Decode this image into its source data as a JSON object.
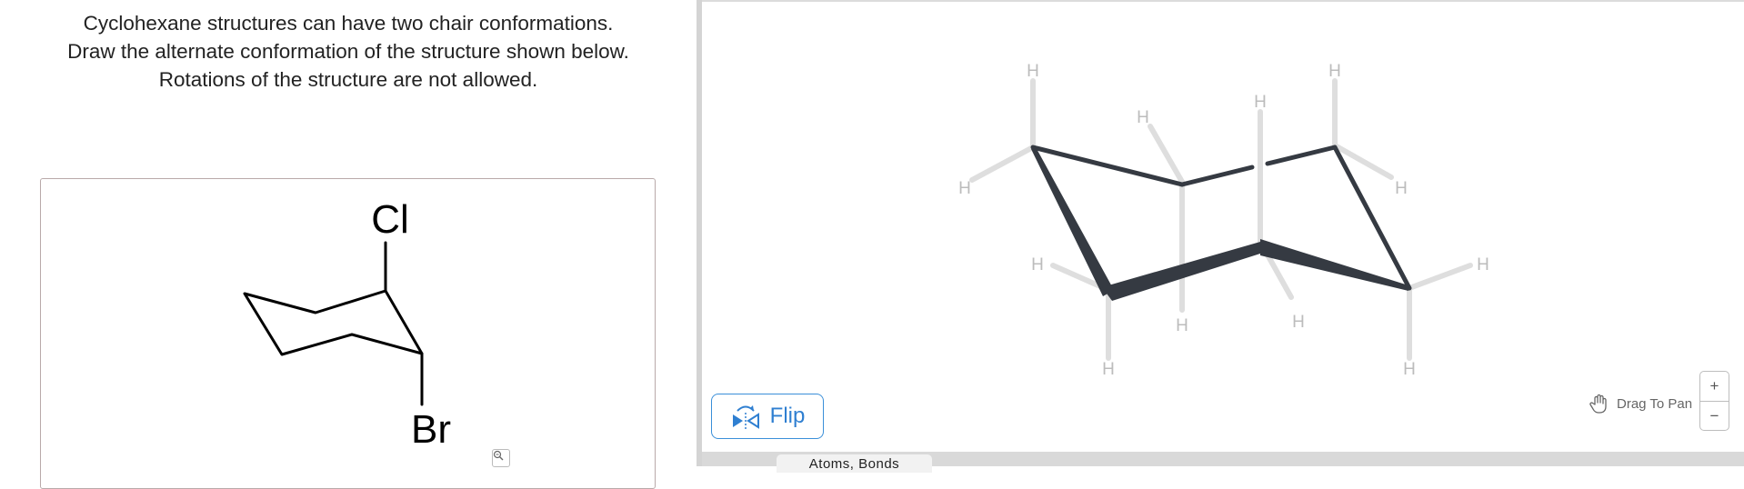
{
  "question": {
    "line1": "Cyclohexane structures can have two chair conformations.",
    "line2": "Draw the alternate conformation of the structure shown below.",
    "line3": "Rotations of the structure are not allowed."
  },
  "structure": {
    "atoms": {
      "top": "Cl",
      "bottom": "Br"
    },
    "zoom_icon": "magnifier-icon"
  },
  "canvas": {
    "hydrogen": "H",
    "bond_color": "#353a42",
    "hydrogen_bond_color": "#dedede",
    "hydrogen_label_color": "#bcbcbc"
  },
  "flip": {
    "label": "Flip",
    "icon": "flip-icon",
    "color": "#2f7fd1"
  },
  "toolbar": {
    "tab_label": "Atoms, Bonds"
  },
  "pan": {
    "label": "Drag To Pan",
    "icon": "hand-icon"
  },
  "zoom": {
    "in_label": "+",
    "out_label": "−"
  }
}
